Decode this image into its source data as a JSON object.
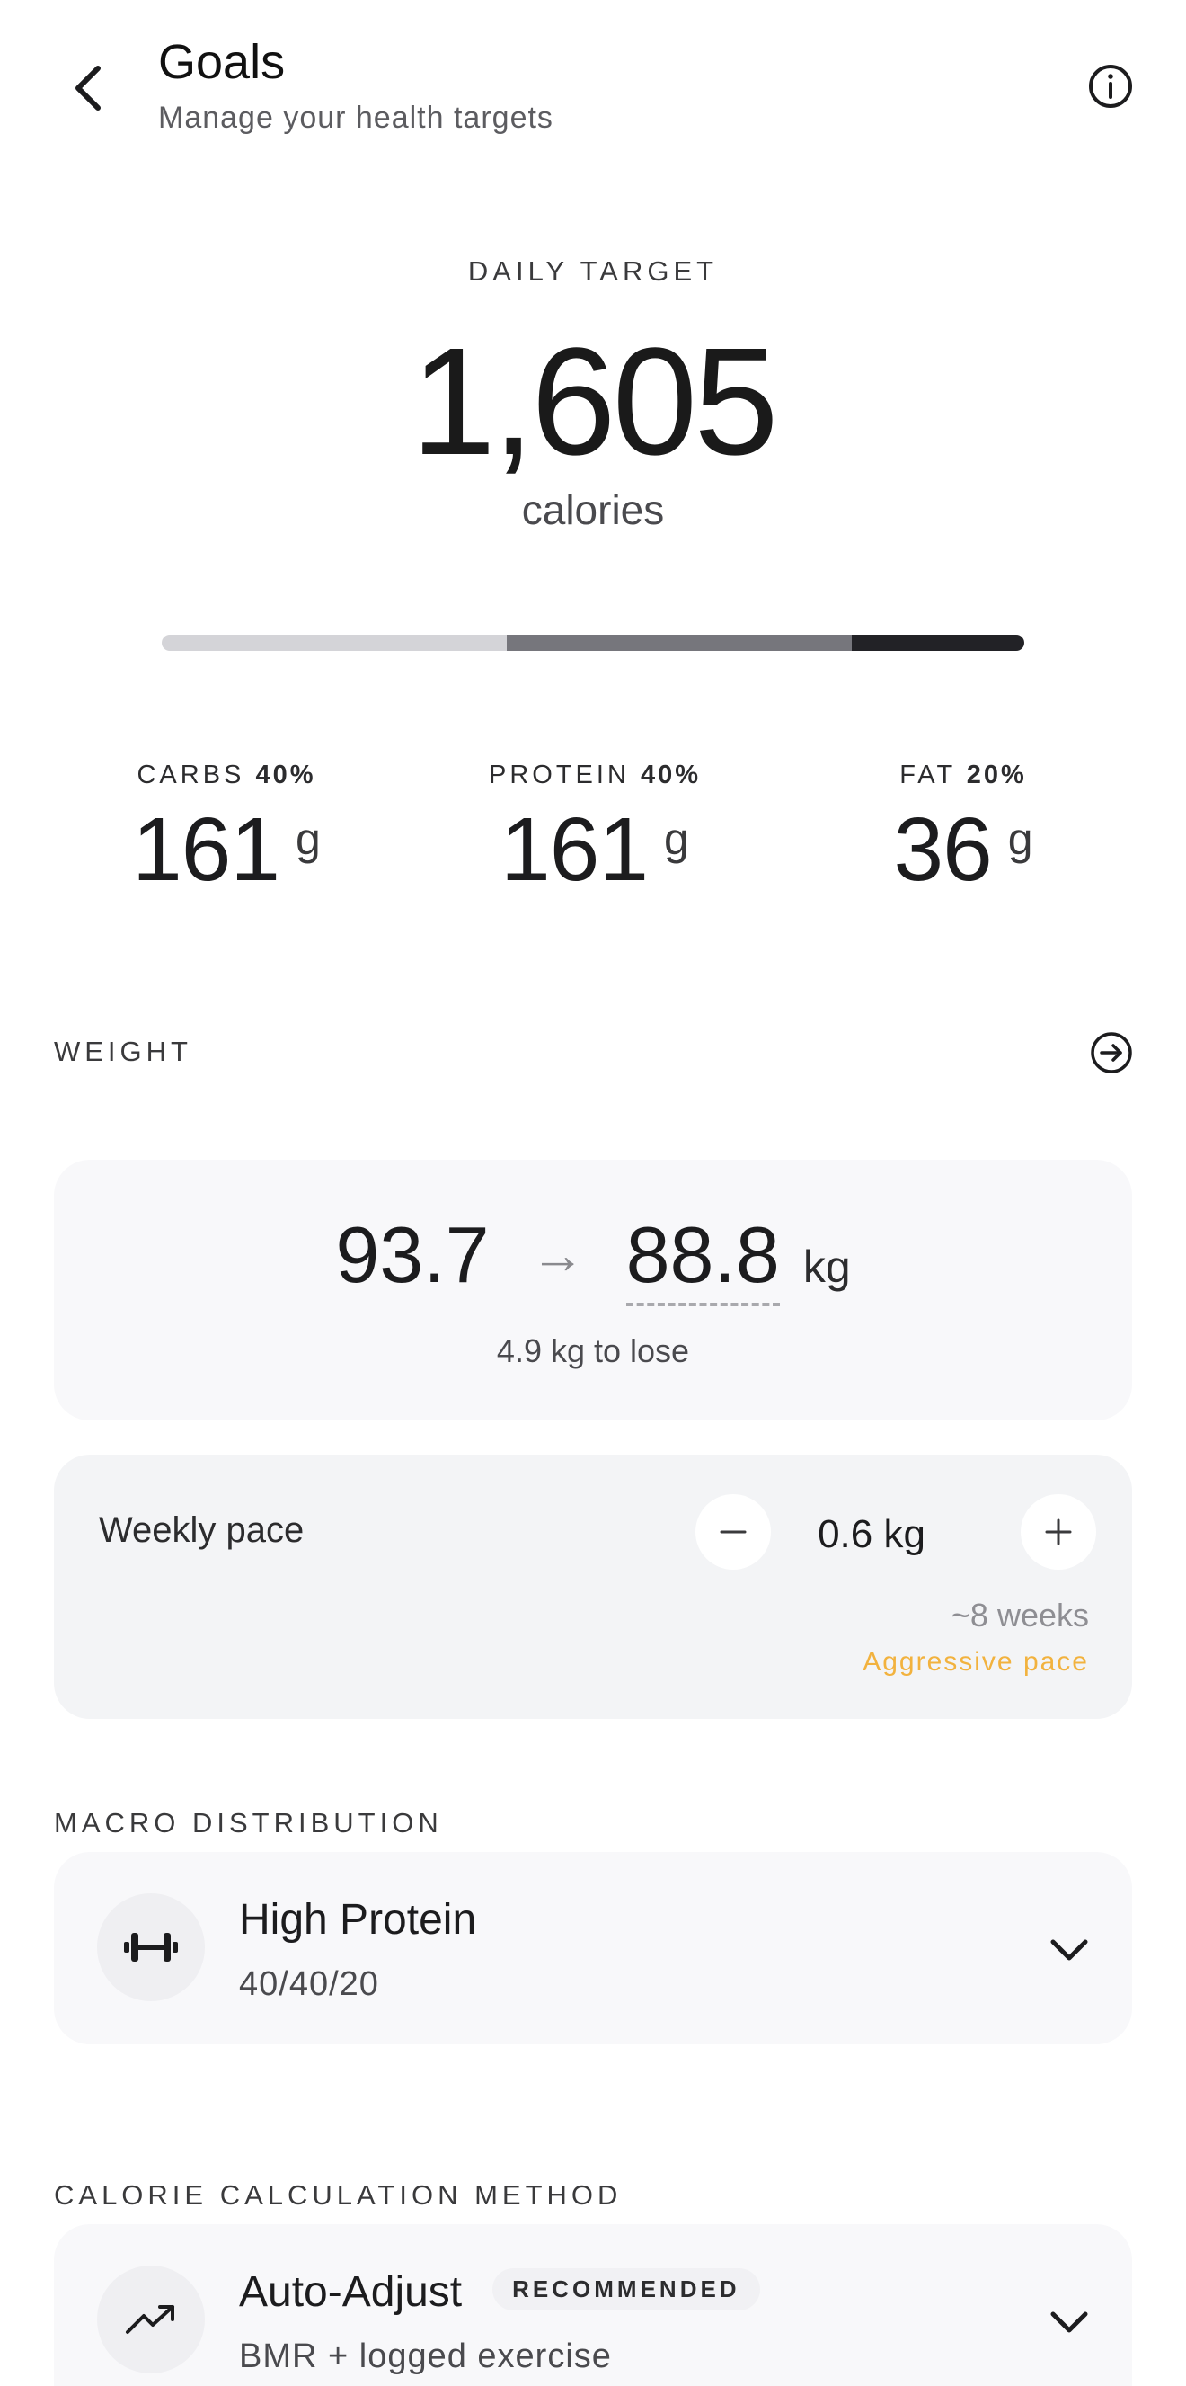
{
  "header": {
    "title": "Goals",
    "subtitle": "Manage your health targets"
  },
  "daily": {
    "label": "DAILY TARGET",
    "value": "1,605",
    "unit": "calories"
  },
  "macro_bar": {
    "segments": [
      {
        "name": "carbs",
        "fraction": 0.4,
        "color": "#d4d4d8"
      },
      {
        "name": "protein",
        "fraction": 0.4,
        "color": "#76767c"
      },
      {
        "name": "fat",
        "fraction": 0.2,
        "color": "#222226"
      }
    ]
  },
  "macros": [
    {
      "label": "CARBS",
      "percent": "40%",
      "value": "161",
      "unit": "g"
    },
    {
      "label": "PROTEIN",
      "percent": "40%",
      "value": "161",
      "unit": "g"
    },
    {
      "label": "FAT",
      "percent": "20%",
      "value": "36",
      "unit": "g"
    }
  ],
  "weight": {
    "section_label": "WEIGHT",
    "current": "93.7",
    "target": "88.8",
    "unit": "kg",
    "to_lose": "4.9 kg to lose"
  },
  "pace": {
    "label": "Weekly pace",
    "value": "0.6 kg",
    "weeks": "~8 weeks",
    "warning": "Aggressive pace",
    "warning_color": "#f2b23e"
  },
  "macro_distribution": {
    "section_label": "MACRO DISTRIBUTION",
    "title": "High Protein",
    "subtitle": "40/40/20",
    "icon": "dumbbell-icon"
  },
  "calorie_method": {
    "section_label": "CALORIE CALCULATION METHOD",
    "title": "Auto-Adjust",
    "badge": "RECOMMENDED",
    "subtitle": "BMR + logged exercise",
    "icon": "trending-up-icon"
  }
}
